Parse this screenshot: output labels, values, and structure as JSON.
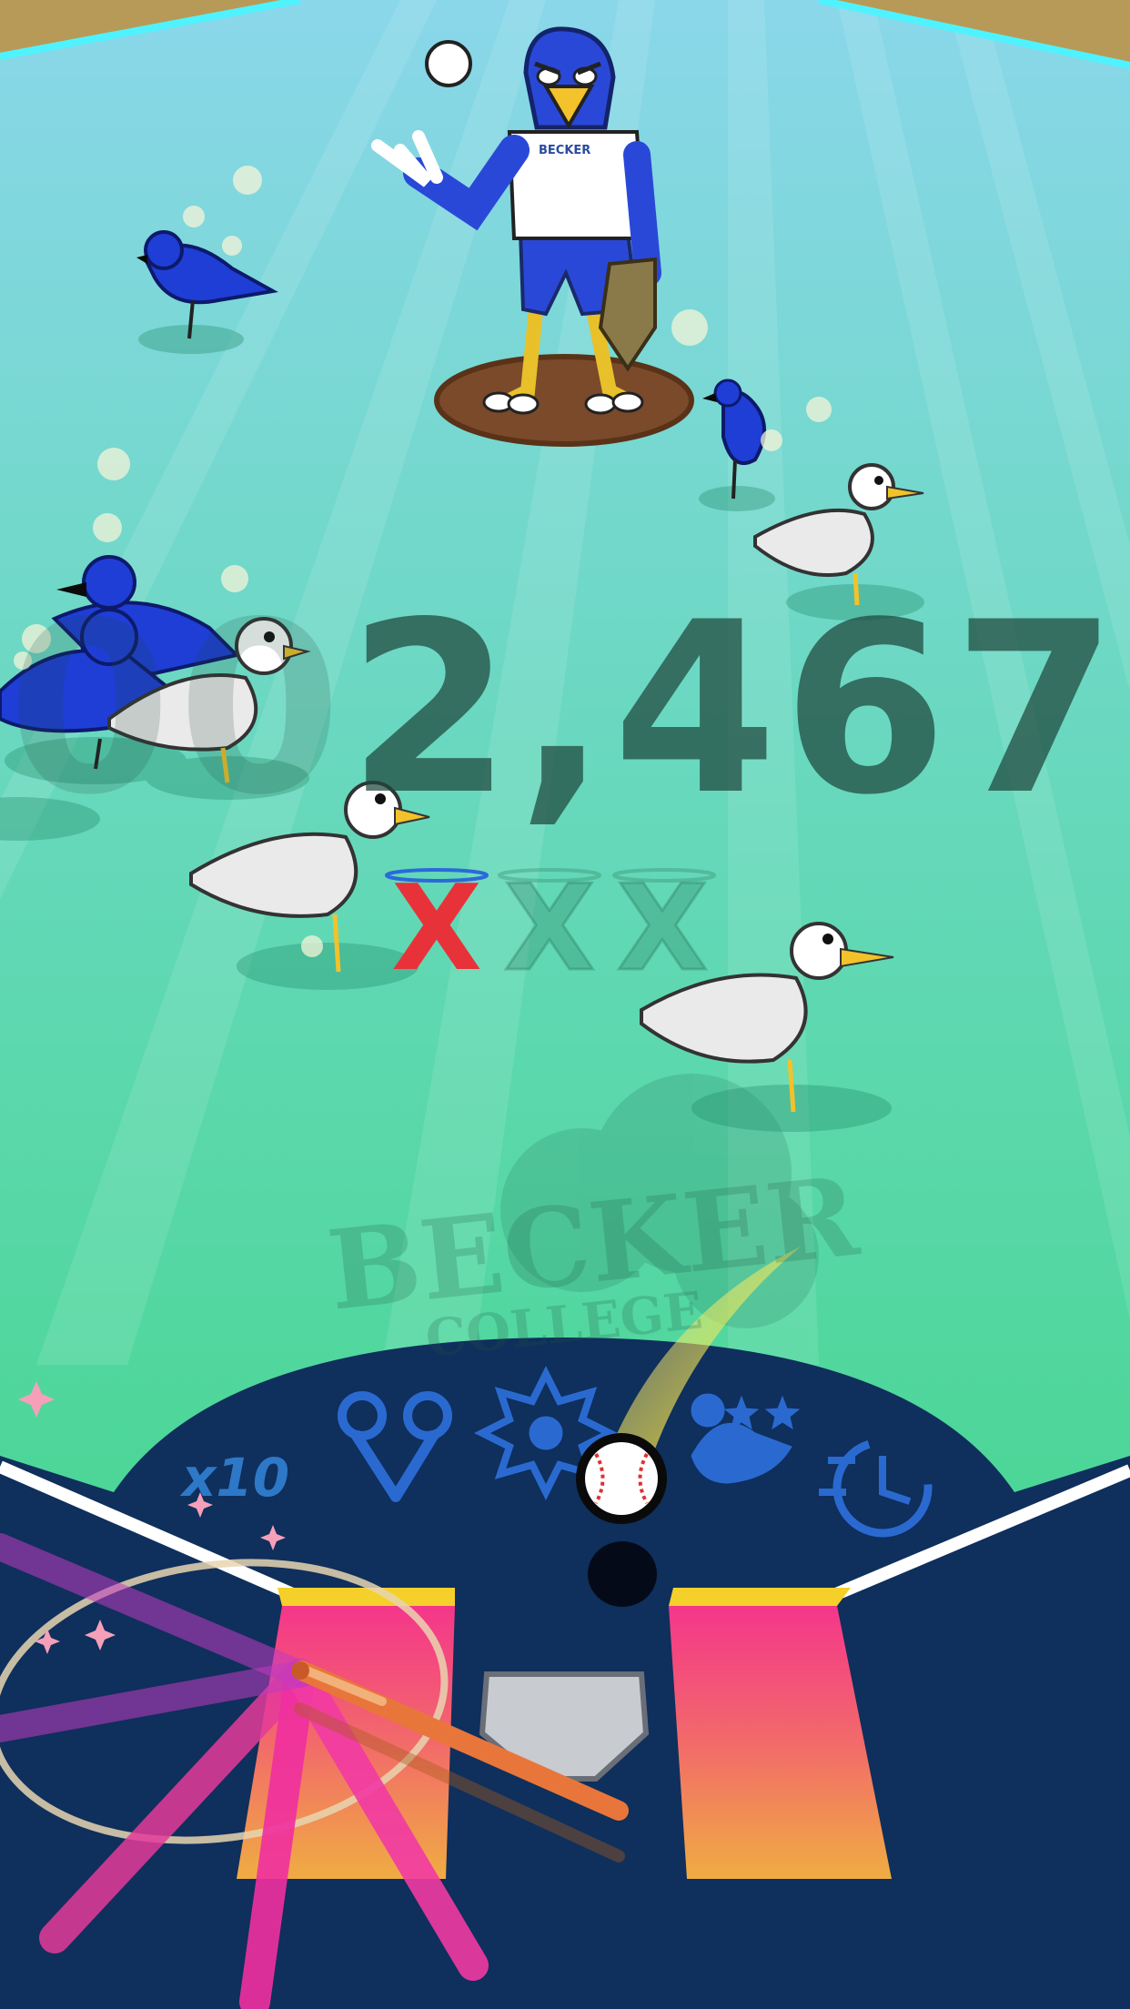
{
  "hud": {
    "score": "2,467",
    "score_ghost_prefix": "00",
    "strikes": [
      {
        "mark": "X",
        "state": "used"
      },
      {
        "mark": "X",
        "state": "remaining"
      },
      {
        "mark": "X",
        "state": "remaining"
      }
    ],
    "multiplier": "x10"
  },
  "field": {
    "logo_main": "BECKER",
    "logo_sub": "COLLEGE",
    "pitcher_shirt": "BECKER"
  },
  "powerups": [
    {
      "icon": "magnet-icon"
    },
    {
      "icon": "explosion-bird-icon"
    },
    {
      "icon": "dizzy-bird-icon"
    },
    {
      "icon": "slow-time-icon"
    }
  ],
  "colors": {
    "field_top": "#8fd8e8",
    "field_bottom": "#3ed67f",
    "dugout": "#0f2f5c",
    "strike_used": "#e8323a",
    "batter_box_top": "#f23a86",
    "batter_box_bottom": "#f0a546",
    "bird_blue": "#1e3ed6",
    "bird_white": "#f2f2f2"
  }
}
